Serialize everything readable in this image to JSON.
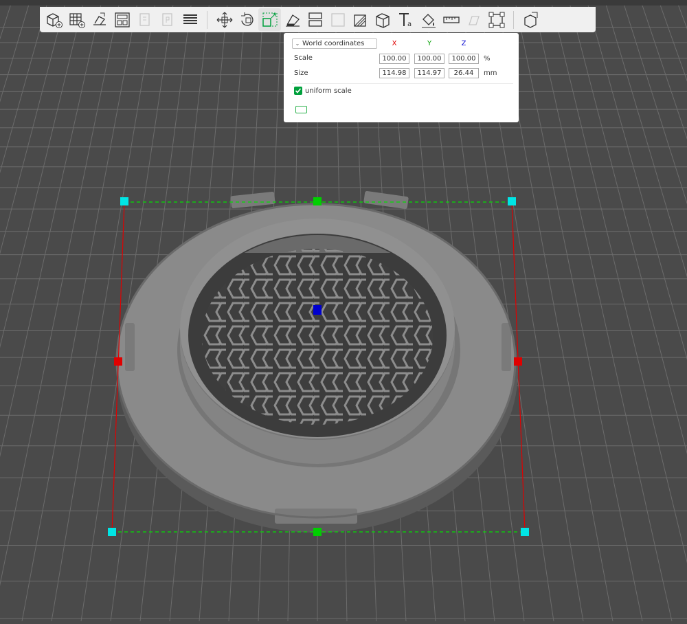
{
  "colors": {
    "background": "#4a4a4a",
    "grid": "#6a6a6a",
    "model": "#8a8a8a",
    "accent_green": "#00c853",
    "accent_red": "#e00000",
    "accent_cyan": "#00e5e5",
    "accent_blue": "#0000d0"
  },
  "toolbar": {
    "items": [
      {
        "name": "add-object-icon",
        "enabled": true
      },
      {
        "name": "add-plate-icon",
        "enabled": true
      },
      {
        "name": "auto-orient-icon",
        "enabled": true
      },
      {
        "name": "arrange-icon",
        "enabled": true
      },
      {
        "name": "copy-icon",
        "enabled": false
      },
      {
        "name": "paste-icon",
        "enabled": false
      },
      {
        "name": "layers-icon",
        "enabled": true
      },
      {
        "name": "move-icon",
        "enabled": true
      },
      {
        "name": "rotate-icon",
        "enabled": true
      },
      {
        "name": "scale-icon",
        "enabled": true,
        "selected": true
      },
      {
        "name": "lay-on-face-icon",
        "enabled": true
      },
      {
        "name": "cut-icon",
        "enabled": true
      },
      {
        "name": "split-icon",
        "enabled": false
      },
      {
        "name": "support-paint-icon",
        "enabled": true
      },
      {
        "name": "seam-paint-icon",
        "enabled": true
      },
      {
        "name": "text-icon",
        "enabled": true
      },
      {
        "name": "color-paint-icon",
        "enabled": true
      },
      {
        "name": "measure-icon",
        "enabled": true
      },
      {
        "name": "brim-ears-icon",
        "enabled": false
      },
      {
        "name": "assembly-icon",
        "enabled": true
      },
      {
        "name": "assembly-view-icon",
        "enabled": true
      }
    ]
  },
  "scale_panel": {
    "coordinate_system": "World coordinates",
    "axis_x": "X",
    "axis_y": "Y",
    "axis_z": "Z",
    "scale_label": "Scale",
    "scale_x": "100.00",
    "scale_y": "100.00",
    "scale_z": "100.00",
    "scale_unit": "%",
    "size_label": "Size",
    "size_x": "114.98",
    "size_y": "114.97",
    "size_z": "26.44",
    "size_unit": "mm",
    "uniform_label": "uniform scale",
    "uniform_checked": true
  }
}
